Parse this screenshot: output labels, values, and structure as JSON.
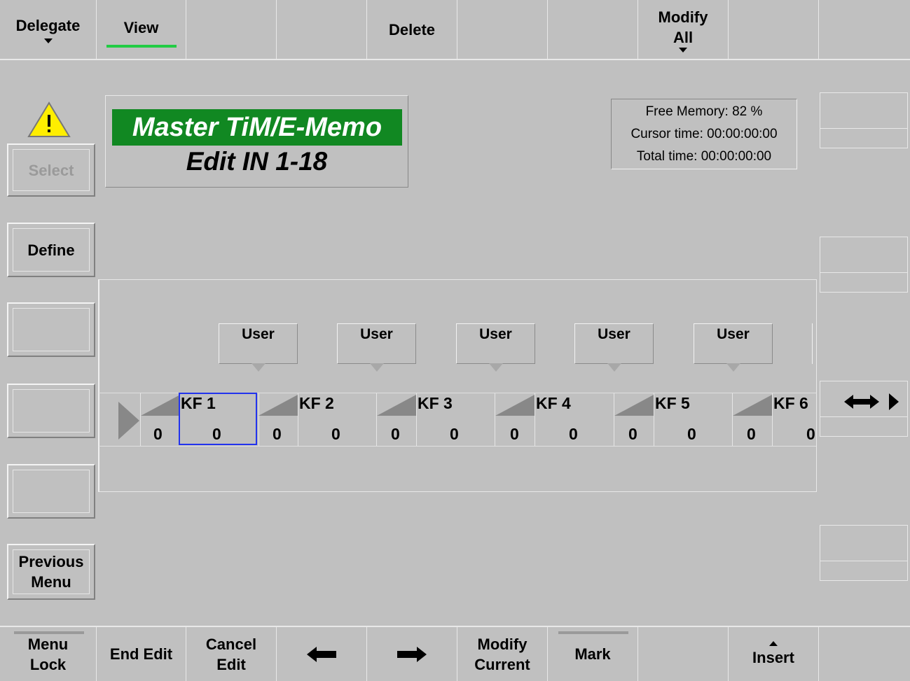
{
  "top_menu": {
    "delegate": "Delegate",
    "view": "View",
    "delete": "Delete",
    "modify_line1": "Modify",
    "modify_line2": "All"
  },
  "left_menu": {
    "select": "Select",
    "define": "Define",
    "previous_line1": "Previous",
    "previous_line2": "Menu"
  },
  "title": {
    "main": "Master TiM/E-Memo",
    "sub": "Edit IN 1-18"
  },
  "info": {
    "free_memory": "Free Memory: 82 %",
    "cursor_time": "Cursor time: 00:00:00:00",
    "total_time": "Total time: 00:00:00:00"
  },
  "timeline": {
    "user_label": "User",
    "keyframes": [
      {
        "label": "KF 1",
        "ramp_value": "0",
        "value": "0"
      },
      {
        "label": "KF 2",
        "ramp_value": "0",
        "value": "0"
      },
      {
        "label": "KF 3",
        "ramp_value": "0",
        "value": "0"
      },
      {
        "label": "KF 4",
        "ramp_value": "0",
        "value": "0"
      },
      {
        "label": "KF 5",
        "ramp_value": "0",
        "value": "0"
      },
      {
        "label": "KF 6",
        "ramp_value": "0",
        "value": "0"
      }
    ],
    "selected_keyframe": 1
  },
  "bottom_menu": {
    "menu_lock_line1": "Menu",
    "menu_lock_line2": "Lock",
    "end_edit": "End Edit",
    "cancel_line1": "Cancel",
    "cancel_line2": "Edit",
    "modify_current_line1": "Modify",
    "modify_current_line2": "Current",
    "mark": "Mark",
    "insert": "Insert"
  },
  "icons": [
    "warning-icon",
    "left-arrow-icon",
    "right-arrow-icon",
    "scroll-arrows-icon",
    "play-triangle-icon"
  ],
  "colors": {
    "title_bg": "#118822",
    "active_indicator": "#22cc44",
    "selection": "#2233ee",
    "warning": "#ffee00"
  }
}
